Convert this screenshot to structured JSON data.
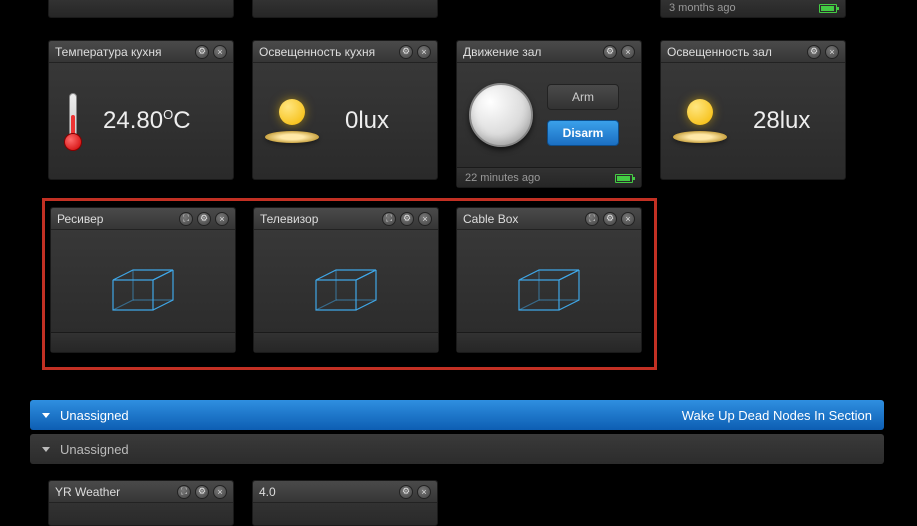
{
  "top_stubs": {
    "time0": "3 months ago"
  },
  "tiles": {
    "temp_kitchen": {
      "title": "Температура кухня",
      "value": "24.80",
      "unit_sup": "O",
      "unit": "C"
    },
    "light_kitchen": {
      "title": "Освещенность кухня",
      "value": "0lux"
    },
    "motion_hall": {
      "title": "Движение зал",
      "arm": "Arm",
      "disarm": "Disarm",
      "footer": "22 minutes ago"
    },
    "light_hall": {
      "title": "Освещенность зал",
      "value": "28lux"
    },
    "receiver": {
      "title": "Ресивер"
    },
    "tv": {
      "title": "Телевизор"
    },
    "cablebox": {
      "title": "Cable Box"
    },
    "yr": {
      "title": "YR Weather"
    },
    "v40": {
      "title": "4.0"
    }
  },
  "sections": {
    "unassigned": "Unassigned",
    "unassigned2": "Unassigned",
    "wake_link": "Wake Up Dead Nodes In Section"
  }
}
